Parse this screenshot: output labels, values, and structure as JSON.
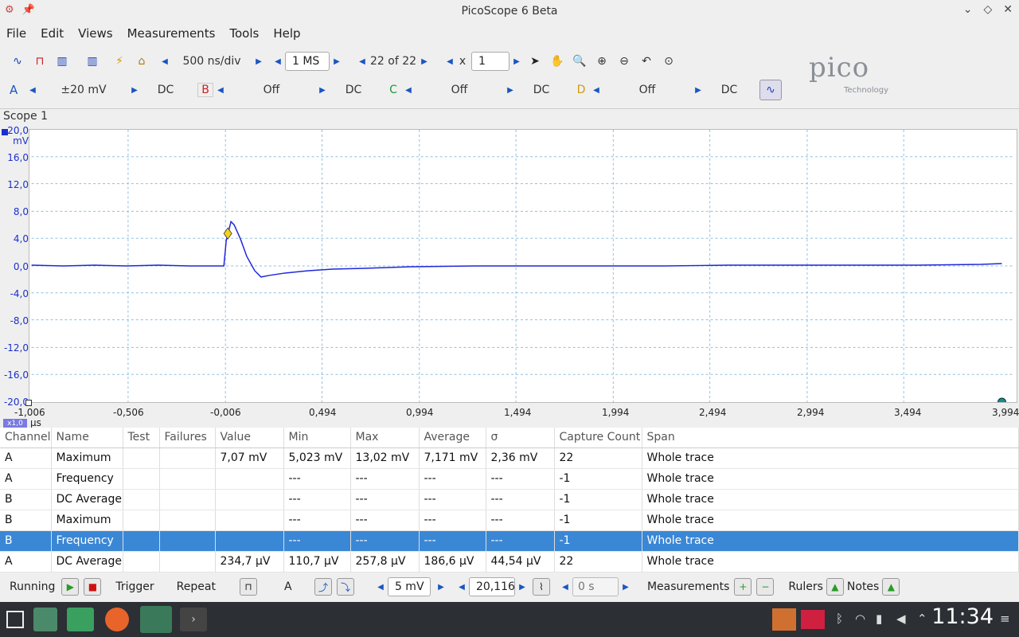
{
  "window": {
    "title": "PicoScope 6 Beta"
  },
  "menu": [
    "File",
    "Edit",
    "Views",
    "Measurements",
    "Tools",
    "Help"
  ],
  "toolbar": {
    "timebase": "500 ns/div",
    "samples": "1 MS",
    "capture": "22 of 22",
    "zoom_label": "x",
    "zoom_value": "1"
  },
  "channels": [
    {
      "letter": "A",
      "range": "±20 mV",
      "coupling": "DC",
      "color": "#1a55c4"
    },
    {
      "letter": "B",
      "range": "Off",
      "coupling": "DC",
      "color": "#d02020"
    },
    {
      "letter": "C",
      "range": "Off",
      "coupling": "DC",
      "color": "#1a9a3a"
    },
    {
      "letter": "D",
      "range": "Off",
      "coupling": "DC",
      "color": "#d09a10"
    }
  ],
  "logo": {
    "name": "pico",
    "sub": "Technology"
  },
  "scope": {
    "title": "Scope 1",
    "y_unit": "mV",
    "y_ticks": [
      "20,0",
      "16,0",
      "12,0",
      "8,0",
      "4,0",
      "0,0",
      "-4,0",
      "-8,0",
      "-12,0",
      "-16,0",
      "-20,0"
    ],
    "x_ticks": [
      "-1,006",
      "-0,506",
      "-0,006",
      "0,494",
      "0,994",
      "1,494",
      "1,994",
      "2,494",
      "2,994",
      "3,494",
      "3,994"
    ],
    "x_unit": "µs",
    "x_zoom": "x1,0"
  },
  "table": {
    "headers": [
      "Channel",
      "Name",
      "Test",
      "Failures",
      "Value",
      "Min",
      "Max",
      "Average",
      "σ",
      "Capture Count",
      "Span"
    ],
    "rows": [
      [
        "A",
        "Maximum",
        "",
        "",
        "7,07 mV",
        "5,023 mV",
        "13,02 mV",
        "7,171 mV",
        "2,36 mV",
        "22",
        "Whole trace"
      ],
      [
        "A",
        "Frequency",
        "",
        "",
        "",
        "---",
        "---",
        "---",
        "---",
        "-1",
        "Whole trace"
      ],
      [
        "B",
        "DC Average",
        "",
        "",
        "",
        "---",
        "---",
        "---",
        "---",
        "-1",
        "Whole trace"
      ],
      [
        "B",
        "Maximum",
        "",
        "",
        "",
        "---",
        "---",
        "---",
        "---",
        "-1",
        "Whole trace"
      ],
      [
        "B",
        "Frequency",
        "",
        "",
        "",
        "---",
        "---",
        "---",
        "---",
        "-1",
        "Whole trace"
      ],
      [
        "A",
        "DC Average",
        "",
        "",
        "234,7 µV",
        "110,7 µV",
        "257,8 µV",
        "186,6 µV",
        "44,54 µV",
        "22",
        "Whole trace"
      ]
    ],
    "selected_row": 4
  },
  "status": {
    "running": "Running",
    "trigger": "Trigger",
    "mode": "Repeat",
    "trig_channel": "A",
    "threshold": "5 mV",
    "pretrigger": "20,116",
    "delay_placeholder": "0 s",
    "measurements": "Measurements",
    "rulers": "Rulers",
    "notes": "Notes"
  },
  "taskbar": {
    "clock": "11:34"
  }
}
